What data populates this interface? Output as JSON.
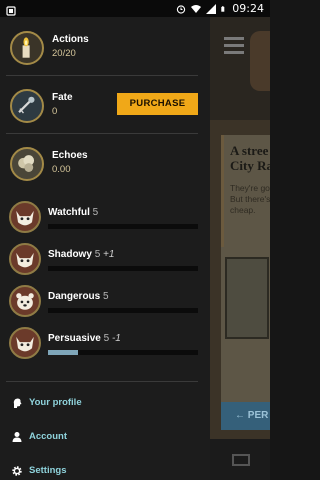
{
  "status_bar": {
    "time": "09:24",
    "icons": [
      "notification-icon",
      "alarm-icon",
      "wifi-icon",
      "signal-icon",
      "battery-icon"
    ]
  },
  "drawer": {
    "qualities": [
      {
        "name": "Actions",
        "value": "20/20",
        "icon": "candle-icon"
      },
      {
        "name": "Fate",
        "value": "0",
        "icon": "fate-icon"
      },
      {
        "name": "Echoes",
        "value": "0.00",
        "icon": "echoes-icon"
      }
    ],
    "purchase_label": "PURCHASE",
    "stats": [
      {
        "name": "Watchful",
        "level": "5",
        "modifier": "",
        "progress": 0
      },
      {
        "name": "Shadowy",
        "level": "5",
        "modifier": "+1",
        "progress": 0
      },
      {
        "name": "Dangerous",
        "level": "5",
        "modifier": "",
        "progress": 0
      },
      {
        "name": "Persuasive",
        "level": "5",
        "modifier": "-1",
        "progress": 0.2
      }
    ],
    "menu": [
      {
        "label": "Your profile",
        "icon": "profile-head-icon",
        "color": "#8fd3dc"
      },
      {
        "label": "Account",
        "icon": "person-icon",
        "color": "#8fd3dc"
      },
      {
        "label": "Settings",
        "icon": "gear-icon",
        "color": "#8fd3dc"
      }
    ]
  },
  "background": {
    "card_title": "A stree\nCity Ra",
    "card_body": "They're go\nBut there's\ncheap.",
    "button_label": "← PER"
  },
  "colors": {
    "accent_gold": "#f0a818",
    "link_teal": "#8fd3dc",
    "drawer_bg": "#1c1c1c"
  }
}
